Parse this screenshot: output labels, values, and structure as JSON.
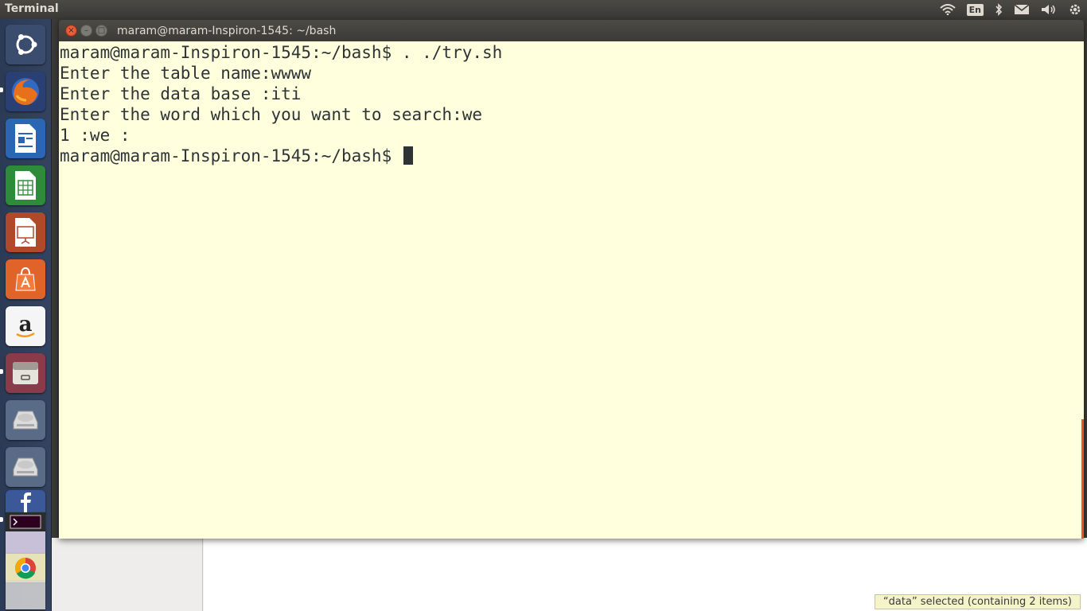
{
  "top_panel": {
    "app_title": "Terminal",
    "keyboard_layout": "En",
    "icons": [
      "wifi-icon",
      "keyboard-layout-indicator",
      "bluetooth-icon",
      "mail-icon",
      "volume-icon",
      "settings-gear-icon"
    ]
  },
  "launcher": {
    "items": [
      "ubuntu-dash",
      "firefox",
      "libreoffice-writer",
      "libreoffice-calc",
      "libreoffice-impress",
      "ubuntu-software-center",
      "amazon",
      "files",
      "drive",
      "drive",
      "facebook",
      "terminal",
      "chrome"
    ]
  },
  "terminal": {
    "window_title": "maram@maram-Inspiron-1545: ~/bash",
    "lines": [
      "maram@maram-Inspiron-1545:~/bash$ . ./try.sh",
      "Enter the table name:wwww",
      "Enter the data base :iti",
      "Enter the word which you want to search:we",
      "1 :we :",
      "maram@maram-Inspiron-1545:~/bash$ "
    ],
    "background_color": "#ffffdd",
    "text_color": "#2e3436"
  },
  "file_manager": {
    "status": "“data” selected  (containing 2 items)"
  }
}
